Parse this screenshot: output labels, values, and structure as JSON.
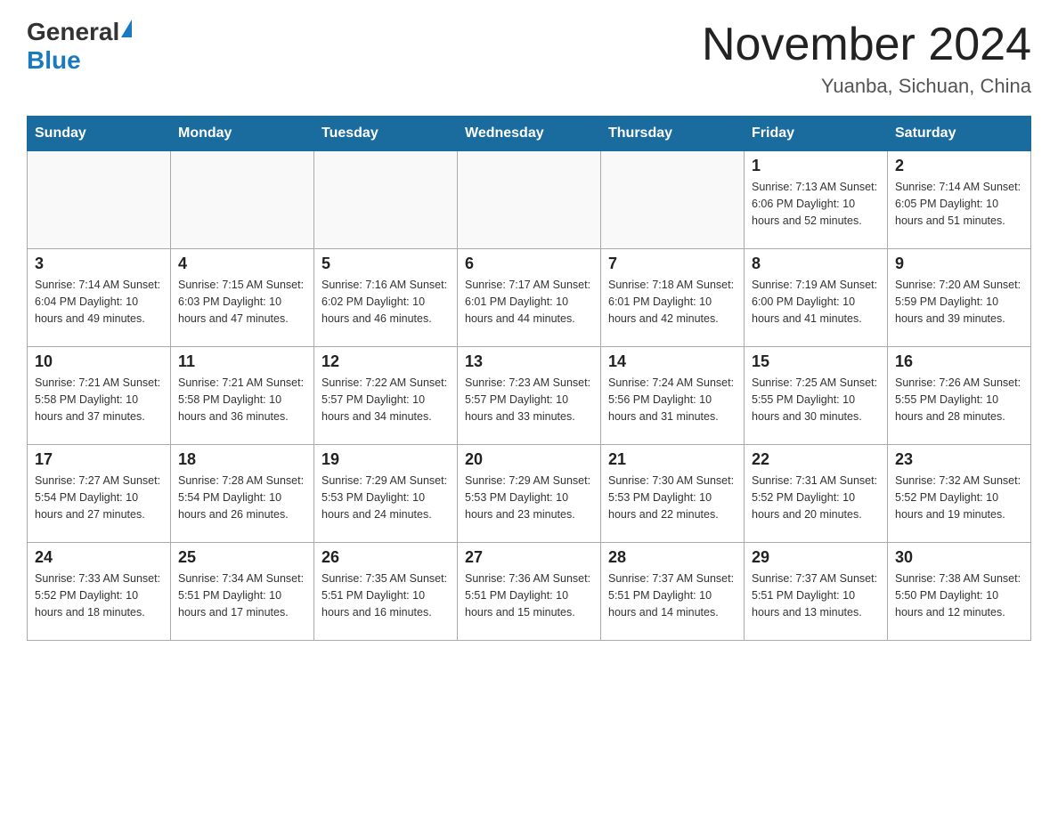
{
  "logo": {
    "general": "General",
    "blue": "Blue"
  },
  "title": "November 2024",
  "location": "Yuanba, Sichuan, China",
  "days_of_week": [
    "Sunday",
    "Monday",
    "Tuesday",
    "Wednesday",
    "Thursday",
    "Friday",
    "Saturday"
  ],
  "weeks": [
    [
      {
        "day": "",
        "info": ""
      },
      {
        "day": "",
        "info": ""
      },
      {
        "day": "",
        "info": ""
      },
      {
        "day": "",
        "info": ""
      },
      {
        "day": "",
        "info": ""
      },
      {
        "day": "1",
        "info": "Sunrise: 7:13 AM\nSunset: 6:06 PM\nDaylight: 10 hours and 52 minutes."
      },
      {
        "day": "2",
        "info": "Sunrise: 7:14 AM\nSunset: 6:05 PM\nDaylight: 10 hours and 51 minutes."
      }
    ],
    [
      {
        "day": "3",
        "info": "Sunrise: 7:14 AM\nSunset: 6:04 PM\nDaylight: 10 hours and 49 minutes."
      },
      {
        "day": "4",
        "info": "Sunrise: 7:15 AM\nSunset: 6:03 PM\nDaylight: 10 hours and 47 minutes."
      },
      {
        "day": "5",
        "info": "Sunrise: 7:16 AM\nSunset: 6:02 PM\nDaylight: 10 hours and 46 minutes."
      },
      {
        "day": "6",
        "info": "Sunrise: 7:17 AM\nSunset: 6:01 PM\nDaylight: 10 hours and 44 minutes."
      },
      {
        "day": "7",
        "info": "Sunrise: 7:18 AM\nSunset: 6:01 PM\nDaylight: 10 hours and 42 minutes."
      },
      {
        "day": "8",
        "info": "Sunrise: 7:19 AM\nSunset: 6:00 PM\nDaylight: 10 hours and 41 minutes."
      },
      {
        "day": "9",
        "info": "Sunrise: 7:20 AM\nSunset: 5:59 PM\nDaylight: 10 hours and 39 minutes."
      }
    ],
    [
      {
        "day": "10",
        "info": "Sunrise: 7:21 AM\nSunset: 5:58 PM\nDaylight: 10 hours and 37 minutes."
      },
      {
        "day": "11",
        "info": "Sunrise: 7:21 AM\nSunset: 5:58 PM\nDaylight: 10 hours and 36 minutes."
      },
      {
        "day": "12",
        "info": "Sunrise: 7:22 AM\nSunset: 5:57 PM\nDaylight: 10 hours and 34 minutes."
      },
      {
        "day": "13",
        "info": "Sunrise: 7:23 AM\nSunset: 5:57 PM\nDaylight: 10 hours and 33 minutes."
      },
      {
        "day": "14",
        "info": "Sunrise: 7:24 AM\nSunset: 5:56 PM\nDaylight: 10 hours and 31 minutes."
      },
      {
        "day": "15",
        "info": "Sunrise: 7:25 AM\nSunset: 5:55 PM\nDaylight: 10 hours and 30 minutes."
      },
      {
        "day": "16",
        "info": "Sunrise: 7:26 AM\nSunset: 5:55 PM\nDaylight: 10 hours and 28 minutes."
      }
    ],
    [
      {
        "day": "17",
        "info": "Sunrise: 7:27 AM\nSunset: 5:54 PM\nDaylight: 10 hours and 27 minutes."
      },
      {
        "day": "18",
        "info": "Sunrise: 7:28 AM\nSunset: 5:54 PM\nDaylight: 10 hours and 26 minutes."
      },
      {
        "day": "19",
        "info": "Sunrise: 7:29 AM\nSunset: 5:53 PM\nDaylight: 10 hours and 24 minutes."
      },
      {
        "day": "20",
        "info": "Sunrise: 7:29 AM\nSunset: 5:53 PM\nDaylight: 10 hours and 23 minutes."
      },
      {
        "day": "21",
        "info": "Sunrise: 7:30 AM\nSunset: 5:53 PM\nDaylight: 10 hours and 22 minutes."
      },
      {
        "day": "22",
        "info": "Sunrise: 7:31 AM\nSunset: 5:52 PM\nDaylight: 10 hours and 20 minutes."
      },
      {
        "day": "23",
        "info": "Sunrise: 7:32 AM\nSunset: 5:52 PM\nDaylight: 10 hours and 19 minutes."
      }
    ],
    [
      {
        "day": "24",
        "info": "Sunrise: 7:33 AM\nSunset: 5:52 PM\nDaylight: 10 hours and 18 minutes."
      },
      {
        "day": "25",
        "info": "Sunrise: 7:34 AM\nSunset: 5:51 PM\nDaylight: 10 hours and 17 minutes."
      },
      {
        "day": "26",
        "info": "Sunrise: 7:35 AM\nSunset: 5:51 PM\nDaylight: 10 hours and 16 minutes."
      },
      {
        "day": "27",
        "info": "Sunrise: 7:36 AM\nSunset: 5:51 PM\nDaylight: 10 hours and 15 minutes."
      },
      {
        "day": "28",
        "info": "Sunrise: 7:37 AM\nSunset: 5:51 PM\nDaylight: 10 hours and 14 minutes."
      },
      {
        "day": "29",
        "info": "Sunrise: 7:37 AM\nSunset: 5:51 PM\nDaylight: 10 hours and 13 minutes."
      },
      {
        "day": "30",
        "info": "Sunrise: 7:38 AM\nSunset: 5:50 PM\nDaylight: 10 hours and 12 minutes."
      }
    ]
  ]
}
